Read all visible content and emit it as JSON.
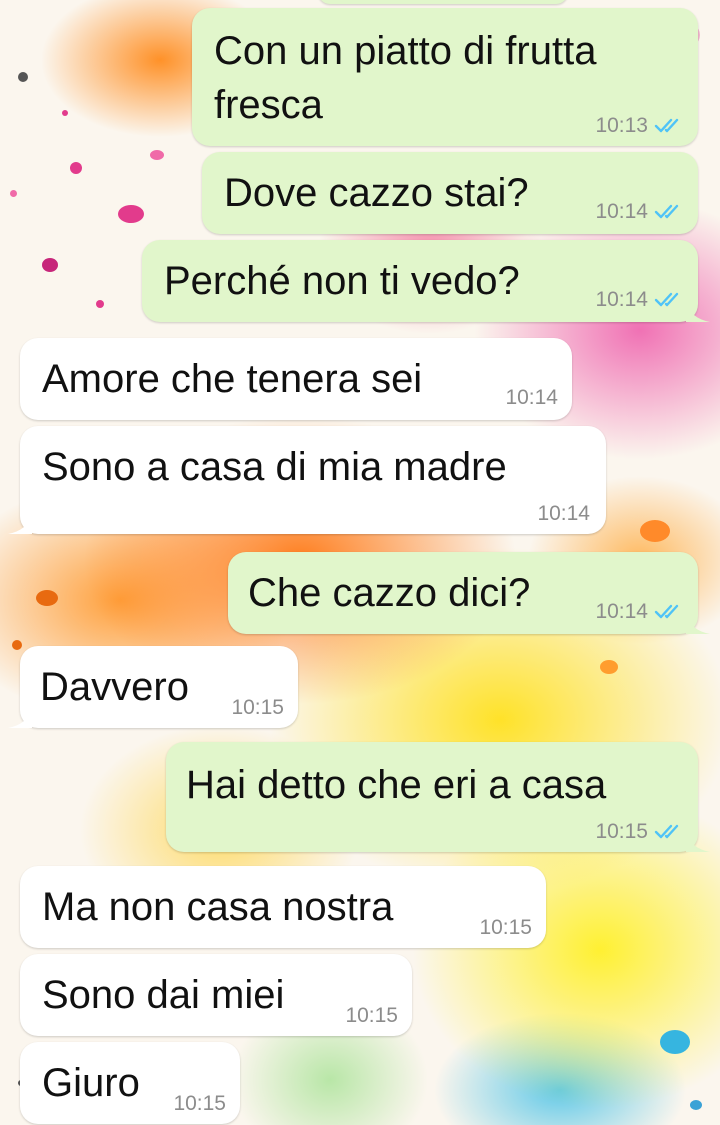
{
  "chat": {
    "messages": [
      {
        "text_lines": [
          "Con un piatto di frutta",
          "fresca"
        ],
        "time": "10:13",
        "direction": "outgoing",
        "status": "read"
      },
      {
        "text": "Dove cazzo stai?",
        "time": "10:14",
        "direction": "outgoing",
        "status": "read"
      },
      {
        "text": "Perché non ti vedo?",
        "time": "10:14",
        "direction": "outgoing",
        "status": "read"
      },
      {
        "text": "Amore che tenera sei",
        "time": "10:14",
        "direction": "incoming"
      },
      {
        "text": "Sono a casa di mia madre",
        "time": "10:14",
        "direction": "incoming"
      },
      {
        "text": "Che cazzo dici?",
        "time": "10:14",
        "direction": "outgoing",
        "status": "read"
      },
      {
        "text": "Davvero",
        "time": "10:15",
        "direction": "incoming"
      },
      {
        "text": "Hai detto che eri a casa",
        "time": "10:15",
        "direction": "outgoing",
        "status": "read"
      },
      {
        "text": "Ma non casa nostra",
        "time": "10:15",
        "direction": "incoming"
      },
      {
        "text": "Sono dai miei",
        "time": "10:15",
        "direction": "incoming"
      },
      {
        "text": "Giuro",
        "time": "10:15",
        "direction": "incoming"
      }
    ]
  },
  "colors": {
    "outgoing_bubble": "#e1f6cb",
    "incoming_bubble": "#ffffff",
    "read_ticks": "#4fc3f7",
    "timestamp": "#8c8c8c"
  },
  "icons": {
    "read_receipt": "double-check-icon"
  }
}
